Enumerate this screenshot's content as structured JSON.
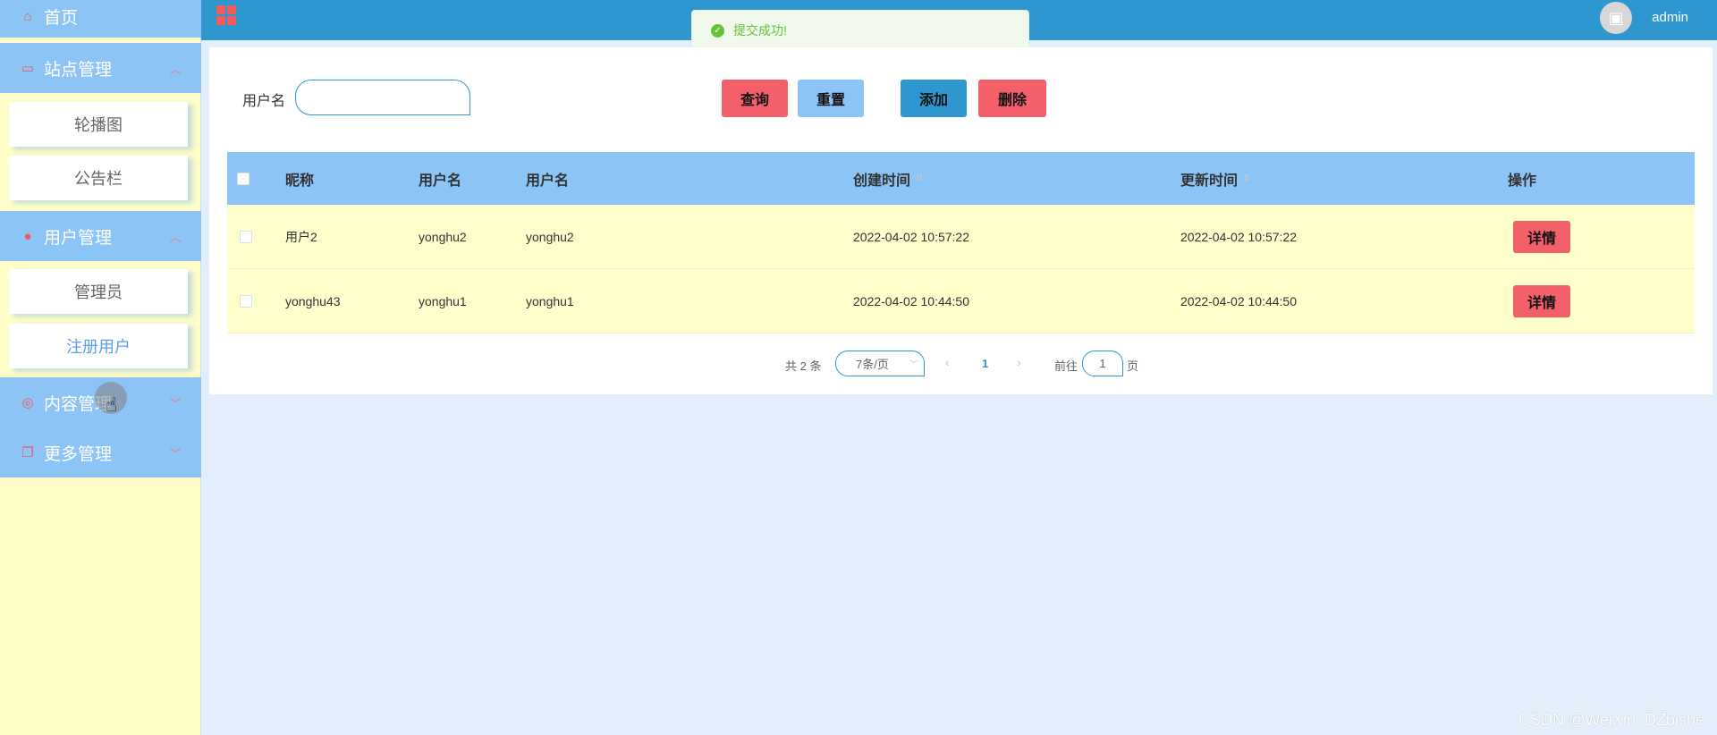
{
  "sidebar": {
    "home": {
      "label": "首页",
      "icon": "home-icon"
    },
    "groups": [
      {
        "label": "站点管理",
        "icon": "monitor-icon",
        "expanded": true,
        "items": [
          "轮播图",
          "公告栏"
        ]
      },
      {
        "label": "用户管理",
        "icon": "user-icon",
        "expanded": true,
        "items": [
          "管理员",
          "注册用户"
        ],
        "active_item": "注册用户"
      },
      {
        "label": "内容管理",
        "icon": "content-icon",
        "expanded": false
      },
      {
        "label": "更多管理",
        "icon": "copy-icon",
        "expanded": false
      }
    ]
  },
  "topbar": {
    "user": "admin"
  },
  "toast": {
    "message": "提交成功!"
  },
  "search": {
    "label": "用户名",
    "value": ""
  },
  "buttons": {
    "query": "查询",
    "reset": "重置",
    "add": "添加",
    "delete": "删除"
  },
  "table": {
    "headers": {
      "nickname": "昵称",
      "username1": "用户名",
      "username2": "用户名",
      "created": "创建时间",
      "updated": "更新时间",
      "actions": "操作"
    },
    "rows": [
      {
        "nickname": "用户2",
        "username1": "yonghu2",
        "username2": "yonghu2",
        "created": "2022-04-02 10:57:22",
        "updated": "2022-04-02 10:57:22",
        "action": "详情"
      },
      {
        "nickname": "yonghu43",
        "username1": "yonghu1",
        "username2": "yonghu1",
        "created": "2022-04-02 10:44:50",
        "updated": "2022-04-02 10:44:50",
        "action": "详情"
      }
    ]
  },
  "pagination": {
    "total": "共 2 条",
    "page_size": "7条/页",
    "current_page": "1",
    "goto_label": "前往",
    "goto_value": "1",
    "page_unit": "页"
  },
  "watermark": "CSDN @WeiXin_DZbishe",
  "colors": {
    "header_blue": "#2f97cf",
    "menu_blue": "#8cc4f6",
    "sidebar_yellow": "#fffec8",
    "row_yellow": "#ffffcc",
    "danger": "#f3606a"
  }
}
